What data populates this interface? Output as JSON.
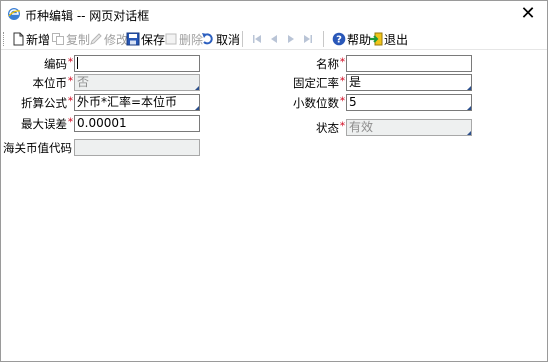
{
  "window": {
    "title": "币种编辑 -- 网页对话框",
    "close_glyph": "✕"
  },
  "toolbar": {
    "new": "新增",
    "copy": "复制",
    "edit": "修改",
    "save": "保存",
    "delete": "删除",
    "cancel": "取消",
    "help": "帮助",
    "exit": "退出"
  },
  "form": {
    "code": {
      "label": "编码",
      "value": ""
    },
    "name": {
      "label": "名称",
      "value": ""
    },
    "base_currency": {
      "label": "本位币",
      "value": "否"
    },
    "fixed_rate": {
      "label": "固定汇率",
      "value": "是"
    },
    "conversion_formula": {
      "label": "折算公式",
      "value": "外币*汇率=本位币"
    },
    "decimal_places": {
      "label": "小数位数",
      "value": "5"
    },
    "max_error": {
      "label": "最大误差",
      "value": "0.00001"
    },
    "status": {
      "label": "状态",
      "value": "有效"
    },
    "customs_code": {
      "label": "海关币值代码",
      "value": ""
    },
    "required_mark": "*"
  },
  "colors": {
    "required": "#d0021b",
    "readonly_bg": "#eef0f0",
    "disabled_text": "#a0a0a0",
    "accent_blue": "#2b4f8c"
  }
}
